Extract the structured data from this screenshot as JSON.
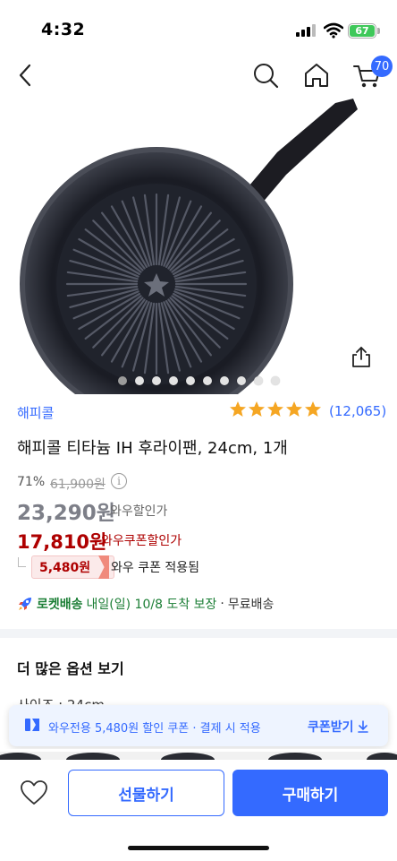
{
  "status_bar": {
    "time": "4:32",
    "battery": "67"
  },
  "nav": {
    "cart_count": "70",
    "icons": [
      "back-icon",
      "search-icon",
      "home-icon",
      "cart-icon"
    ]
  },
  "gallery": {
    "total_images": 10,
    "active_index": 0
  },
  "product": {
    "brand": "해피콜",
    "rating_stars": 5,
    "review_count": "(12,065)",
    "title": "해피콜 티타늄 IH 후라이팬, 24cm, 1개",
    "discount_rate": "71%",
    "original_price": "61,900원",
    "wow_price": "23,290원",
    "wow_price_label": "와우할인가",
    "coupon_price": "17,810원",
    "coupon_price_label": "와우쿠폰할인가",
    "coupon_amount": "5,480원",
    "coupon_applied_text": "와우 쿠폰 적용됨"
  },
  "delivery": {
    "name": "로켓배송",
    "date": "내일(일) 10/8 도착 보장",
    "separator": "·",
    "free": "무료배송"
  },
  "options": {
    "heading": "더 많은 옵션 보기",
    "peek": "사이즈 : 24cm"
  },
  "coupon_banner": {
    "text": "와우전용 5,480원 할인 쿠폰 · 결제 시 적용",
    "link": "쿠폰받기"
  },
  "bottom_bar": {
    "gift_label": "선물하기",
    "buy_label": "구매하기"
  },
  "colors": {
    "accent": "#346aff",
    "price_red": "#ae0000",
    "rocket_green": "#1b7e35",
    "star": "#f5a623"
  }
}
